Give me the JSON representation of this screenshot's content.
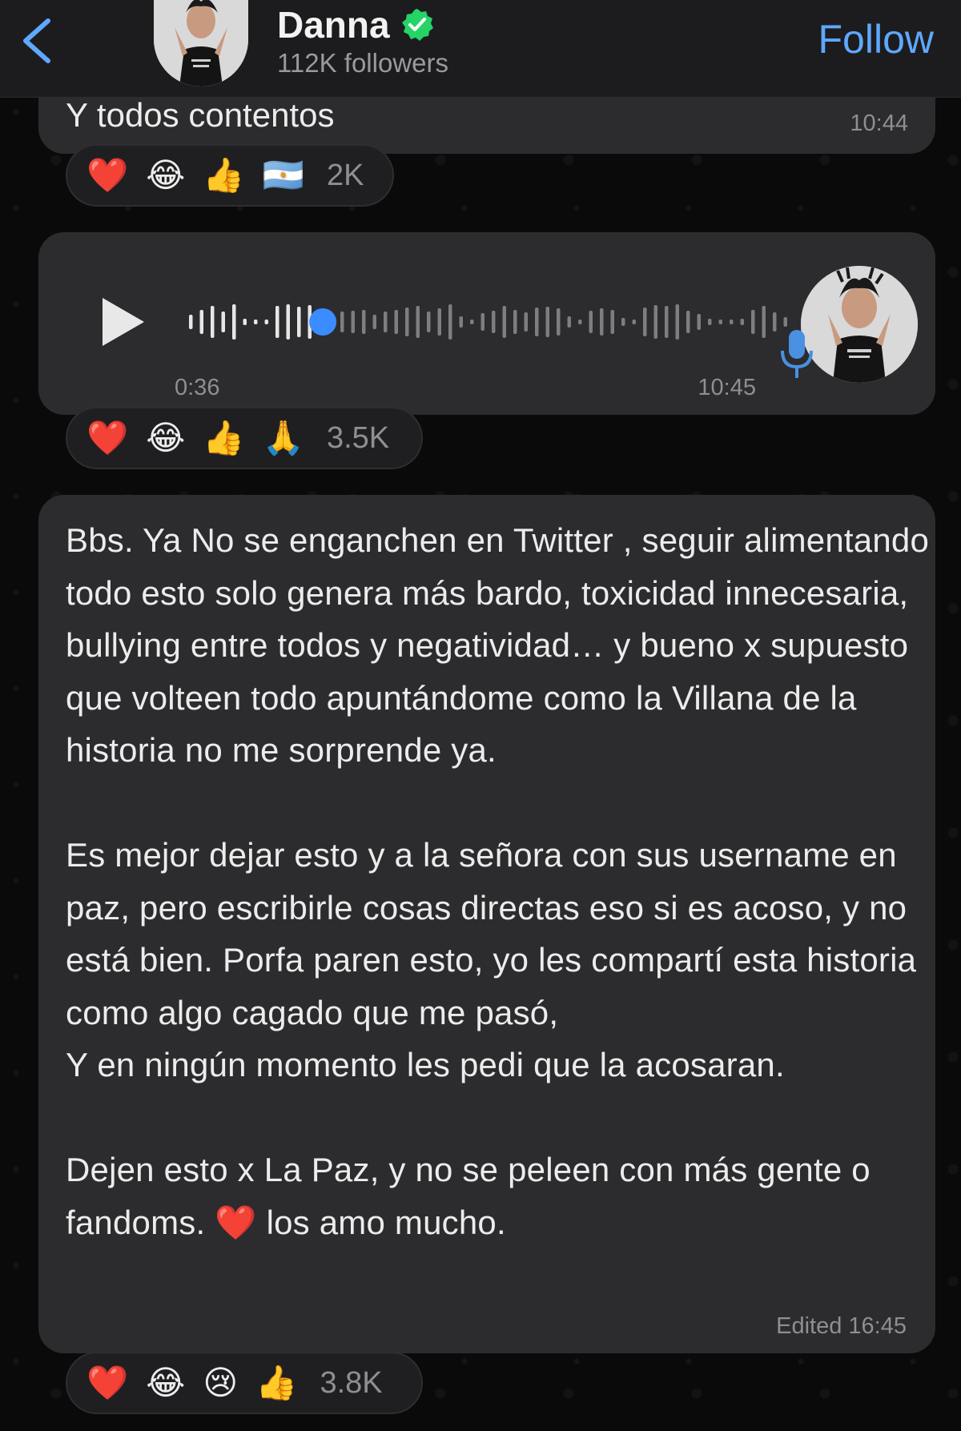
{
  "header": {
    "back_icon": "chevron-left-icon",
    "channel_name": "Danna",
    "verified_icon": "verified-check-icon",
    "followers": "112K followers",
    "follow_label": "Follow"
  },
  "messages": [
    {
      "text": "Y todos contentos",
      "time": "10:44",
      "reactions": [
        "❤️",
        "😂",
        "👍",
        "🇦🇷"
      ],
      "reaction_count": "2K"
    },
    {
      "type": "voice",
      "duration": "0:36",
      "time": "10:45",
      "playback_progress": 0.23,
      "reactions": [
        "❤️",
        "😂",
        "👍",
        "🙏"
      ],
      "reaction_count": "3.5K"
    },
    {
      "text": "Bbs. Ya No se enganchen en Twitter , seguir alimentando todo esto solo genera más bardo, toxicidad innecesaria, bullying entre todos y negatividad… y bueno x supuesto que volteen todo apuntándome como la Villana de la historia no me sorprende ya.\n\nEs mejor dejar esto y a la señora con sus username en paz, pero escribirle cosas directas eso si es acoso, y no está bien. Porfa paren esto, yo les compartí esta historia como algo cagado que me pasó,\nY en ningún momento les pedi que la acosaran.\n\nDejen esto x La Paz, y no se peleen con más gente o fandoms. ❤️ los amo mucho.",
      "edited_label": "Edited",
      "time": "16:45",
      "reactions": [
        "❤️",
        "😂",
        "😢",
        "👍"
      ],
      "reaction_count": "3.8K"
    }
  ],
  "colors": {
    "accent": "#5fa8ff",
    "bubble": "#2c2c2e",
    "verified": "#25d366",
    "heart": "#e0252f"
  }
}
